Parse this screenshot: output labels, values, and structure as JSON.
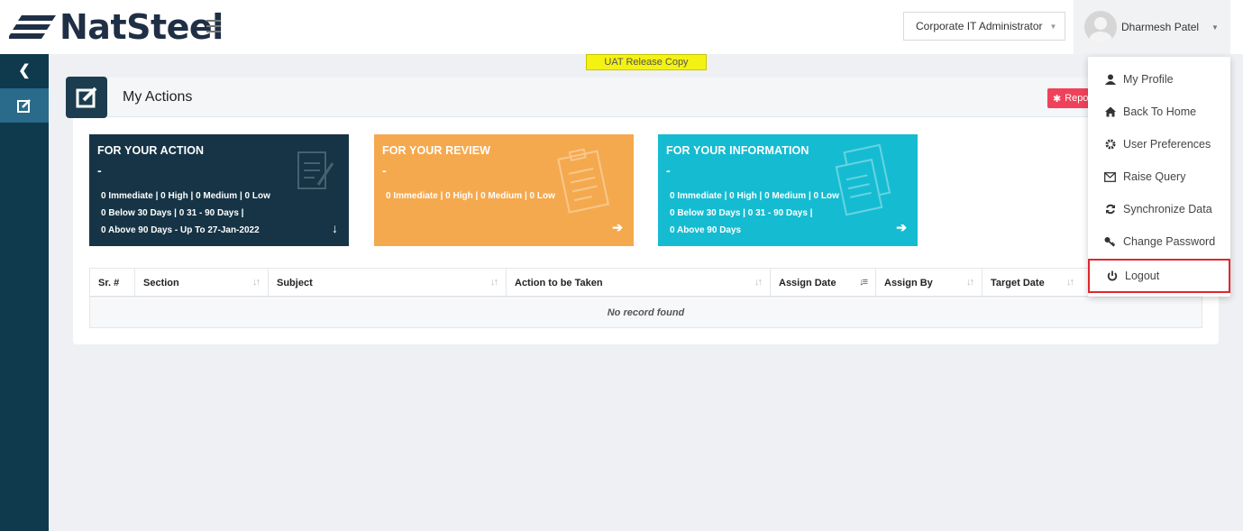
{
  "header": {
    "brand": "NatSteel",
    "role_select": "Corporate IT Administrator",
    "user_name": "Dharmesh Patel"
  },
  "banner": "UAT Release Copy",
  "page": {
    "title": "My Actions",
    "report_button": "Repo"
  },
  "cards": {
    "action": {
      "title": "FOR YOUR ACTION",
      "count": "-",
      "line1": "0  Immediate | 0 High | 0 Medium | 0 Low",
      "line2": "0 Below 30 Days | 0  31 - 90 Days |",
      "line3": "0 Above 90 Days  - Up To 27-Jan-2022",
      "arrow": "↓"
    },
    "review": {
      "title": "FOR YOUR REVIEW",
      "count": "-",
      "line1": "0  Immediate | 0 High | 0 Medium | 0 Low",
      "arrow": "➔"
    },
    "info": {
      "title": "FOR YOUR INFORMATION",
      "count": "-",
      "line1": "0  Immediate |  0 High | 0 Medium | 0 Low",
      "line2": "0 Below 30 Days | 0  31 - 90 Days |",
      "line3": "0 Above 90 Days",
      "arrow": "➔"
    }
  },
  "table": {
    "columns": [
      "Sr. #",
      "Section",
      "Subject",
      "Action to be Taken",
      "Assign Date",
      "Assign By",
      "Target Date"
    ],
    "empty_text": "No record found"
  },
  "user_menu": {
    "items": [
      "My Profile",
      "Back To Home",
      "User Preferences",
      "Raise Query",
      "Synchronize Data",
      "Change Password",
      "Logout"
    ]
  },
  "colors": {
    "sidebar": "#0f3a4d",
    "card_action": "#163445",
    "card_review": "#f5a94e",
    "card_info": "#15bcd1",
    "logout_highlight": "#e0272f",
    "report_button": "#f0415a"
  }
}
